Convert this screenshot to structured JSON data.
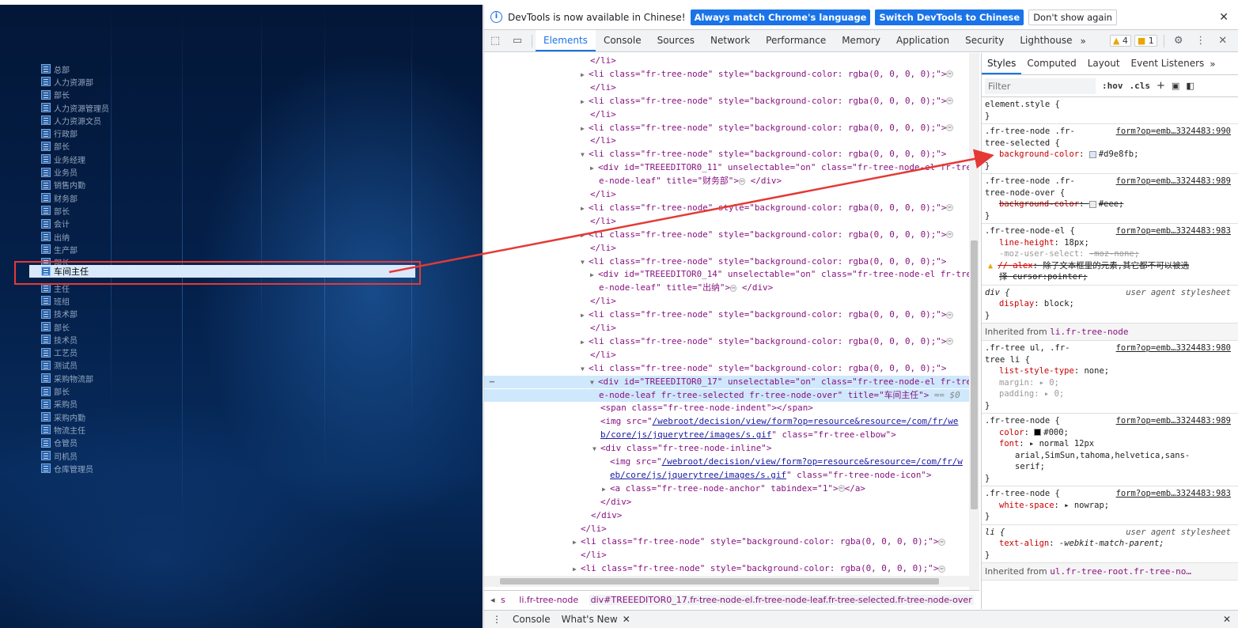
{
  "tree": {
    "items": [
      "总部",
      "人力资源部",
      "部长",
      "人力资源管理员",
      "人力资源文员",
      "行政部",
      "部长",
      "业务经理",
      "业务员",
      "销售内勤",
      "财务部",
      "部长",
      "会计",
      "出纳",
      "生产部",
      "部长",
      "车间主任",
      "主任",
      "班组",
      "技术部",
      "部长",
      "技术员",
      "工艺员",
      "测试员",
      "采购物流部",
      "部长",
      "采购员",
      "采购内勤",
      "物流主任",
      "仓管员",
      "司机员",
      "仓库管理员"
    ],
    "selected_label": "车间主任"
  },
  "devtools": {
    "infobar": {
      "message": "DevTools is now available in Chinese!",
      "btn_match": "Always match Chrome's language",
      "btn_switch": "Switch DevTools to Chinese",
      "btn_dismiss": "Don't show again"
    },
    "tabs": [
      "Elements",
      "Console",
      "Sources",
      "Network",
      "Performance",
      "Memory",
      "Application",
      "Security",
      "Lighthouse"
    ],
    "warnings": "4",
    "issues": "1",
    "elements_lines": {
      "li_close": "</li>",
      "li_open": "<li class=\"fr-tree-node\" style=\"background-color: rgba(0, 0, 0, 0);\">",
      "div11": "<div id=\"TREEEDITOR0_11\" unselectable=\"on\" class=\"fr-tree-node-el fr-tre",
      "div11b": "e-node-leaf\" title=\"财务部\">",
      "div14": "<div id=\"TREEEDITOR0_14\" unselectable=\"on\" class=\"fr-tree-node-el fr-tre",
      "div14b": "e-node-leaf\" title=\"出纳\">",
      "div17": "<div id=\"TREEEDITOR0_17\" unselectable=\"on\" class=\"fr-tree-node-el fr-tre",
      "div17b": "e-node-leaf fr-tree-selected fr-tree-node-over\" title=\"车间主任\">",
      "eq": "== $0",
      "span": "<span class=\"fr-tree-node-indent\"></span>",
      "img1a": "/webroot/decision/view/form?op=resource&resource=/com/fr/we",
      "img1b": "b/core/js/jquerytree/images/s.gif",
      "img1c": "class=\"fr-tree-elbow\">",
      "inline": "<div class=\"fr-tree-node-inline\">",
      "img2a": "/webroot/decision/view/form?op=resource&resource=/com/fr/w",
      "img2b": "eb/core/js/jquerytree/images/s.gif",
      "img2c": "class=\"fr-tree-node-icon\">",
      "anchor": "<a class=\"fr-tree-node-anchor\" tabindex=\"1\">",
      "div_close": "</div>",
      "a_close": "</a>",
      "div_close_text": "</div>"
    },
    "breadcrumb": {
      "prefix": "s",
      "item1": "li.fr-tree-node",
      "item2": "div#TREEEDITOR0_17.fr-tree-node-el.fr-tree-node-leaf.fr-tree-selected.fr-tree-node-over"
    },
    "style_tabs": [
      "Styles",
      "Computed",
      "Layout",
      "Event Listeners"
    ],
    "filter_placeholder": "Filter",
    "hov": ":hov",
    "cls": ".cls",
    "styles": {
      "element_style": "element.style {",
      "close": "}",
      "r1_sel": ".fr-tree-node .fr-",
      "r1_sel2": "tree-selected {",
      "r1_src": "form?op=emb…3324483:990",
      "r1_prop": "background-color",
      "r1_val": "#d9e8fb;",
      "r2_sel": ".fr-tree-node .fr-",
      "r2_sel2": "tree-node-over {",
      "r2_src": "form?op=emb…3324483:989",
      "r2_prop": "background-color",
      "r2_val": "#eee;",
      "r3_sel": ".fr-tree-node-el {",
      "r3_src": "form?op=emb…3324483:983",
      "r3_p1": "line-height",
      "r3_v1": "18px;",
      "r3_p2": "-moz-user-select",
      "r3_v2": "-moz-none;",
      "r3_p3": "// alex",
      "r3_v3": "除了文本框里的元素,其它都不可以被选",
      "r3_v3b": "择 cursor:pointer;",
      "r4_sel": "div {",
      "r4_src": "user agent stylesheet",
      "r4_p": "display",
      "r4_v": "block;",
      "inh1_label": "Inherited from",
      "inh1_target": "li.fr-tree-node",
      "r5_sel": ".fr-tree ul, .fr-",
      "r5_sel2": "tree li {",
      "r5_src": "form?op=emb…3324483:980",
      "r5_p1": "list-style-type",
      "r5_v1": "none;",
      "r5_p2": "margin",
      "r5_v2": "0;",
      "r5_p3": "padding",
      "r5_v3": "0;",
      "r6_sel": ".fr-tree-node {",
      "r6_src": "form?op=emb…3324483:989",
      "r6_p1": "color",
      "r6_v1": "#000;",
      "r6_p2": "font",
      "r6_v2": "normal 12px",
      "r6_v2b": "arial,SimSun,tahoma,helvetica,sans-",
      "r6_v2c": "serif;",
      "r7_sel": ".fr-tree-node {",
      "r7_src": "form?op=emb…3324483:983",
      "r7_p": "white-space",
      "r7_v": "nowrap;",
      "r8_sel": "li {",
      "r8_src": "user agent stylesheet",
      "r8_p": "text-align",
      "r8_v": "-webkit-match-parent;",
      "inh2_label": "Inherited from",
      "inh2_target": "ul.fr-tree-root.fr-tree-no…"
    },
    "drawer": {
      "tab1": "Console",
      "tab2": "What's New"
    }
  },
  "colors": {
    "accent": "#1a73e8",
    "selection": "#d9e8fb",
    "annotation": "#e53935"
  }
}
